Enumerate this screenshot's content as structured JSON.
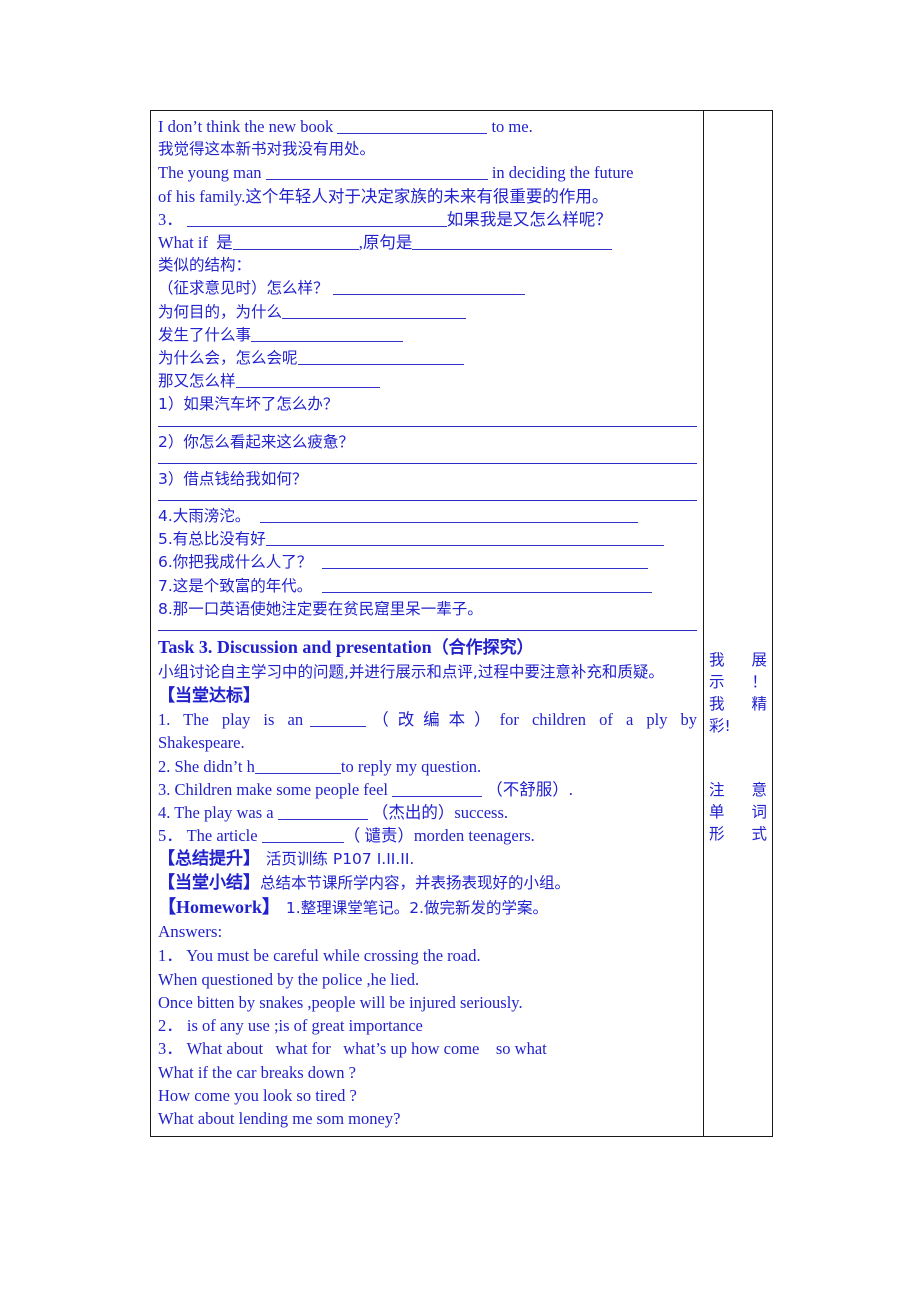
{
  "document": {
    "text_color": "#2222cc",
    "border_color": "#1a1a1a",
    "page_background": "#ffffff"
  },
  "main_column": {
    "section_translation": {
      "line1_en": "I don’t think the new book",
      "line1_en_tail": "to me.",
      "line2_cn": "我觉得这本新书对我没有用处。",
      "line3_en": "The young man",
      "line3_en_tail": "in deciding the future",
      "line4_mix": "of his family.这个年轻人对于决定家族的未来有很重要的作用。",
      "line5_num": "3．",
      "line5_tail": "如果我是又怎么样呢？",
      "line6_a": "What if  是",
      "line6_b": ",原句是"
    },
    "similar_structures": {
      "heading": "类似的结构：",
      "items": [
        "（征求意见时）怎么样？",
        "为何目的，为什么",
        "发生了什么事",
        "为什么会，怎么会呢",
        "那又怎么样"
      ]
    },
    "numbered_questions": [
      "1）如果汽车坏了怎么办？",
      "2）你怎么看起来这么疲惫？",
      "3）借点钱给我如何？"
    ],
    "sentence_items": [
      "4.大雨滂沱。",
      "5.有总比没有好",
      "6.你把我成什么人了？",
      "7.这是个致富的年代。",
      "8.那一口英语使她注定要在贫民窟里呆一辈子。"
    ],
    "task3": {
      "title_en": "Task 3. Discussion and presentation",
      "title_cn": "（合作探究）",
      "body": "小组讨论自主学习中的问题,并进行展示和点评,过程中要注意补充和质疑。"
    },
    "dangtang_dabiao": {
      "heading": "【当堂达标】",
      "q1_a": "1.  The  play  is  an",
      "q1_b": "（ 改 编 本 ）",
      "q1_c": "for  children  of  a  ply  by",
      "q1_d": "Shakespeare.",
      "q2_a": "2. She didn’t h",
      "q2_b": "to reply my question.",
      "q3_a": "3. Children make some people feel",
      "q3_b": "（不舒服）.",
      "q4_a": "4. The play was a",
      "q4_b": "（杰出的）success.",
      "q5_a": "5． The article",
      "q5_b": "（ 谴责）morden teenagers."
    },
    "summary_blocks": [
      {
        "label": "【总结提升】",
        "text": "活页训练 P107 I.II.II.",
        "text_style": "cn"
      },
      {
        "label": "【当堂小结】",
        "text": "总结本节课所学内容，并表扬表现好的小组。",
        "text_style": "cn"
      },
      {
        "label": "【Homework】",
        "text": "1.整理课堂笔记。2.做完新发的学案。",
        "text_style": "cn"
      }
    ],
    "answers": {
      "heading": "Answers:",
      "lines": [
        "1． You must be careful while crossing the road.",
        "When questioned by the police ,he lied.",
        "Once bitten by snakes ,people will be injured seriously.",
        "2． is of any use ;is of great importance",
        "3． What about   what for   what’s up how come    so what",
        "What if the car breaks down ?",
        "How come you look so tired ?",
        "What about lending me som money?"
      ]
    }
  },
  "side_column": {
    "note_show": {
      "line1_left": "我",
      "line1_right": "展",
      "line2_left": "示",
      "line2_right": "！",
      "line3_left": "我",
      "line3_right": "精",
      "line4": "彩!"
    },
    "note_attention": {
      "line1_left": "注",
      "line1_right": "意",
      "line2_left": "单",
      "line2_right": "词",
      "line3_left": "形",
      "line3_right": "式"
    }
  }
}
